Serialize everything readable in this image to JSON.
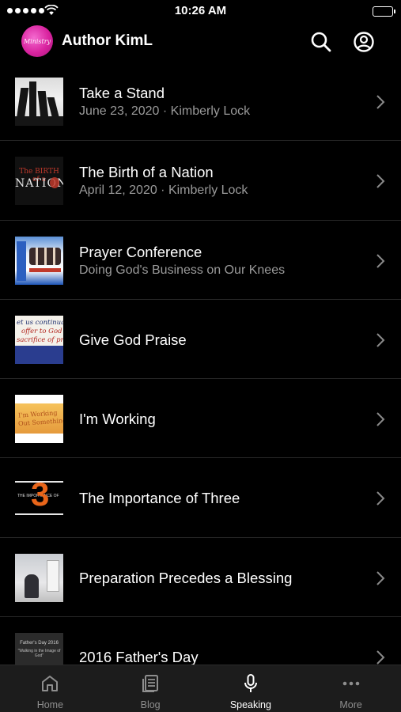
{
  "status_bar": {
    "time": "10:26 AM"
  },
  "header": {
    "app_title": "Author KimL",
    "logo_text": "Ministry"
  },
  "items": [
    {
      "title": "Take a Stand",
      "subtitle": "June 23, 2020 · Kimberly Lock",
      "thumb": "raised-hands-photo"
    },
    {
      "title": "The Birth of a Nation",
      "subtitle": "April 12, 2020 · Kimberly Lock",
      "thumb": "birth-of-a-nation-art",
      "thumb_text_1": "The BIRTH of a",
      "thumb_text_2": "NATION"
    },
    {
      "title": "Prayer Conference",
      "subtitle": "Doing God's Business on Our Knees",
      "thumb": "prayer-conference-flyer"
    },
    {
      "title": "Give God Praise",
      "subtitle": "",
      "thumb": "praise-scripture-art",
      "thumb_lines": [
        "et us continual",
        "offer to God a",
        "sacrifice of prais"
      ]
    },
    {
      "title": "I'm Working",
      "subtitle": "",
      "thumb": "im-working-art",
      "thumb_lines": [
        "I'm Working",
        "Out Something"
      ]
    },
    {
      "title": "The Importance of Three",
      "subtitle": "",
      "thumb": "importance-of-three-art",
      "thumb_text": "THE IMPORTANCE OF",
      "thumb_number": "3"
    },
    {
      "title": "Preparation Precedes a Blessing",
      "subtitle": "",
      "thumb": "preparation-photo"
    },
    {
      "title": "2016 Father's Day",
      "subtitle": "",
      "thumb": "fathers-day-art",
      "thumb_text_1": "Father's Day 2016",
      "thumb_text_2": "\"Walking in the Image of God\""
    }
  ],
  "tabs": [
    {
      "label": "Home",
      "icon": "home-icon",
      "active": false
    },
    {
      "label": "Blog",
      "icon": "blog-icon",
      "active": false
    },
    {
      "label": "Speaking",
      "icon": "microphone-icon",
      "active": true
    },
    {
      "label": "More",
      "icon": "more-icon",
      "active": false
    }
  ],
  "colors": {
    "background": "#000000",
    "tabbar": "#1c1c1c",
    "subtitle": "#9a9a9a",
    "logo": "#d9239f",
    "inactive_tab": "#8e8e8e"
  }
}
